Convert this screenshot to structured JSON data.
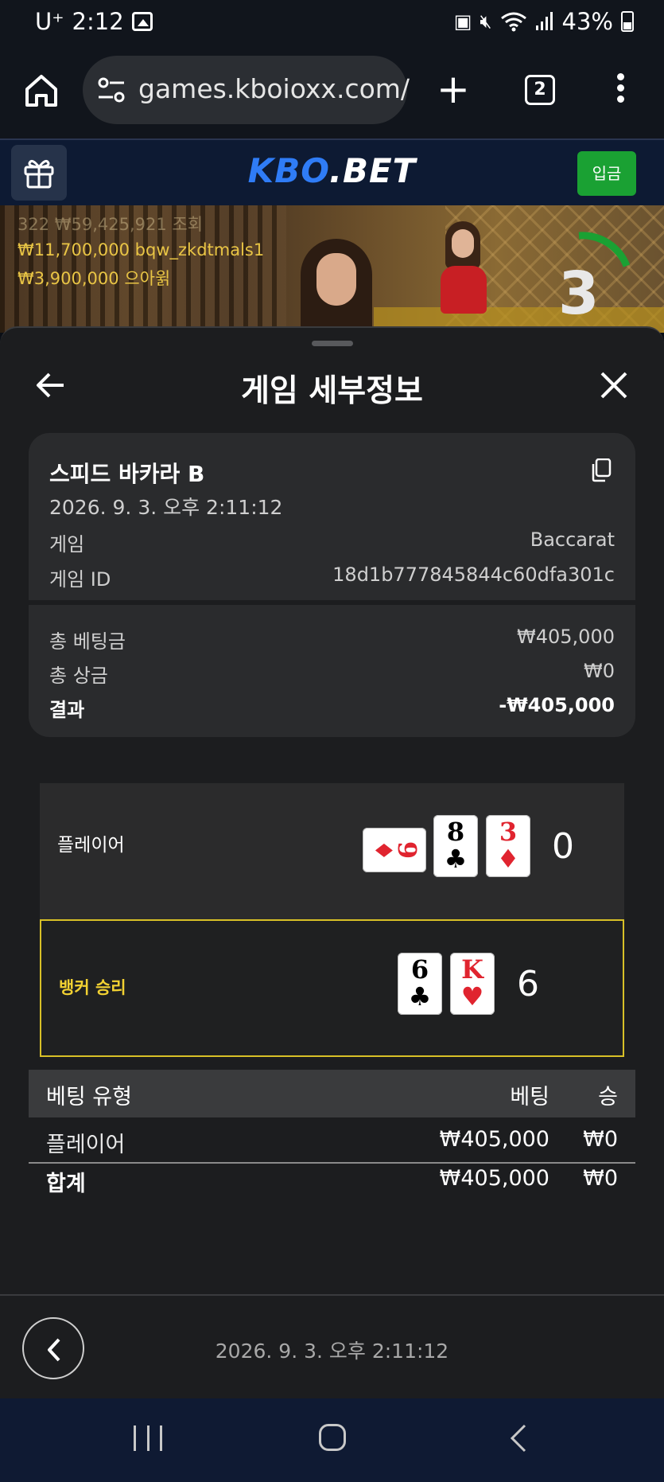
{
  "status_bar": {
    "carrier": "U⁺",
    "time": "2:12",
    "battery": "43%",
    "icons": [
      "gallery-icon",
      "nfc-icon",
      "mute-icon",
      "wifi-icon",
      "signal-icon",
      "battery-icon"
    ]
  },
  "browser": {
    "url": "games.kboioxx.com/",
    "tab_count": "2"
  },
  "site": {
    "logo_left": "KBO",
    "logo_right": ".BET",
    "deposit_label": "입금",
    "brand_color": "#2f7cf6",
    "deposit_color": "#1aa133"
  },
  "banner": {
    "ticker_faded": "322 ₩59,425,921 조회",
    "tickers": [
      "₩11,700,000  bqw_zkdtmals1",
      "₩3,900,000  으아윍"
    ],
    "countdown": "3"
  },
  "sheet": {
    "title": "게임 세부정보",
    "summary": {
      "game_title": "스피드 바카라 B",
      "datetime": "2026. 9. 3. 오후 2:11:12",
      "game_label": "게임",
      "game_value": "Baccarat",
      "game_id_label": "게임 ID",
      "game_id_value": "18d1b777845844c60dfa301c",
      "total_bet_label": "총 베팅금",
      "total_bet_value": "₩405,000",
      "total_prize_label": "총 상금",
      "total_prize_value": "₩0",
      "result_label": "결과",
      "result_value": "-₩405,000"
    },
    "result": {
      "player_label": "플레이어",
      "player_cards": [
        {
          "rank": "9",
          "suit": "♦",
          "color": "red",
          "sideways": true
        },
        {
          "rank": "8",
          "suit": "♣",
          "color": "black"
        },
        {
          "rank": "3",
          "suit": "♦",
          "color": "red"
        }
      ],
      "player_score": "0",
      "banker_label": "뱅커 승리",
      "banker_cards": [
        {
          "rank": "6",
          "suit": "♣",
          "color": "black"
        },
        {
          "rank": "K",
          "suit": "♥",
          "color": "red"
        }
      ],
      "banker_score": "6",
      "winner_color": "#f2d132"
    },
    "bets": {
      "headers": [
        "베팅 유형",
        "베팅",
        "승"
      ],
      "rows": [
        {
          "type": "플레이어",
          "bet": "₩405,000",
          "win": "₩0"
        }
      ],
      "total": {
        "type": "합계",
        "bet": "₩405,000",
        "win": "₩0"
      }
    },
    "footer_date": "2026. 9. 3. 오후 2:11:12"
  }
}
